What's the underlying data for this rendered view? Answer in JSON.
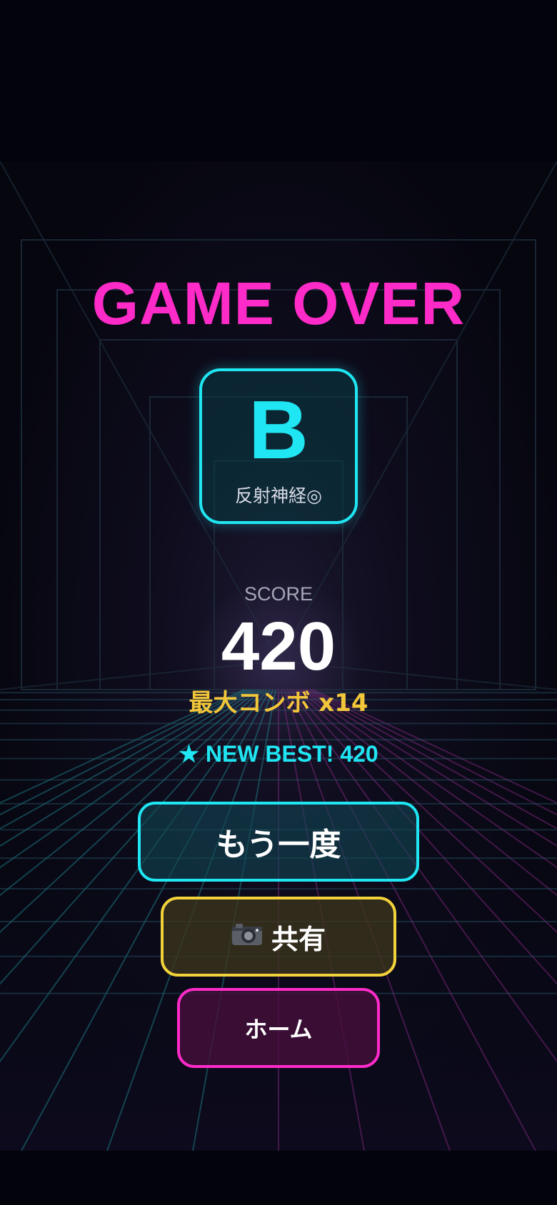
{
  "title": "GAME OVER",
  "grade": {
    "letter": "B",
    "caption": "反射神経◎"
  },
  "score": {
    "label": "SCORE",
    "value": "420"
  },
  "combo": "最大コンボ x14",
  "best": "★ NEW BEST! 420",
  "buttons": {
    "retry": "もう一度",
    "share_icon": "camera-icon",
    "share": "共有",
    "home": "ホーム"
  },
  "colors": {
    "title": "#ff2bc9",
    "accent": "#1fe6f2",
    "gold": "#f2c63a",
    "share_border": "#f2d23a",
    "home_border": "#ff2bc9",
    "background": "#06060f"
  }
}
